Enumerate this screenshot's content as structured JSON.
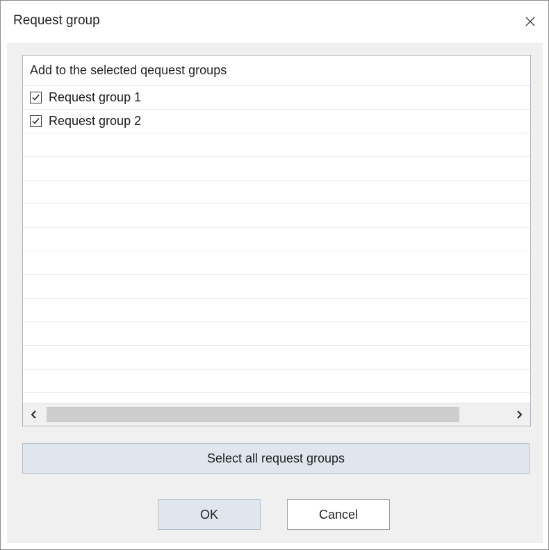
{
  "window": {
    "title": "Request group",
    "close_icon": "close-icon"
  },
  "list": {
    "header": "Add to the selected qequest groups",
    "items": [
      {
        "label": "Request group 1",
        "checked": true
      },
      {
        "label": "Request group 2",
        "checked": true
      }
    ],
    "empty_rows": 12,
    "scroll_left_icon": "chevron-left-icon",
    "scroll_right_icon": "chevron-right-icon"
  },
  "buttons": {
    "select_all": "Select all request groups",
    "ok": "OK",
    "cancel": "Cancel"
  },
  "colors": {
    "client_bg": "#f0f0f0",
    "button_bg": "#dfe6ee",
    "row_line": "#e6ecf2"
  }
}
